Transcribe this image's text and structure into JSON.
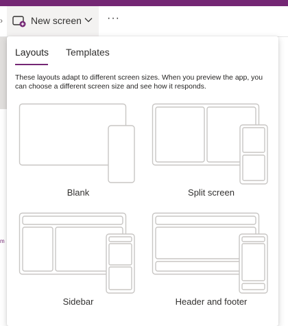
{
  "toolbar": {
    "new_screen_label": "New screen",
    "more_label": "···"
  },
  "sidebar": {
    "fragment_text": "m"
  },
  "panel": {
    "tabs": [
      {
        "label": "Layouts",
        "selected": true
      },
      {
        "label": "Templates",
        "selected": false
      }
    ],
    "description": "These layouts adapt to different screen sizes. When you preview the app, you can choose a different screen size and see how it responds.",
    "layouts": [
      {
        "label": "Blank"
      },
      {
        "label": "Split screen"
      },
      {
        "label": "Sidebar"
      },
      {
        "label": "Header and footer"
      }
    ]
  },
  "colors": {
    "accent": "#742774",
    "outline": "#c8c6c4"
  }
}
